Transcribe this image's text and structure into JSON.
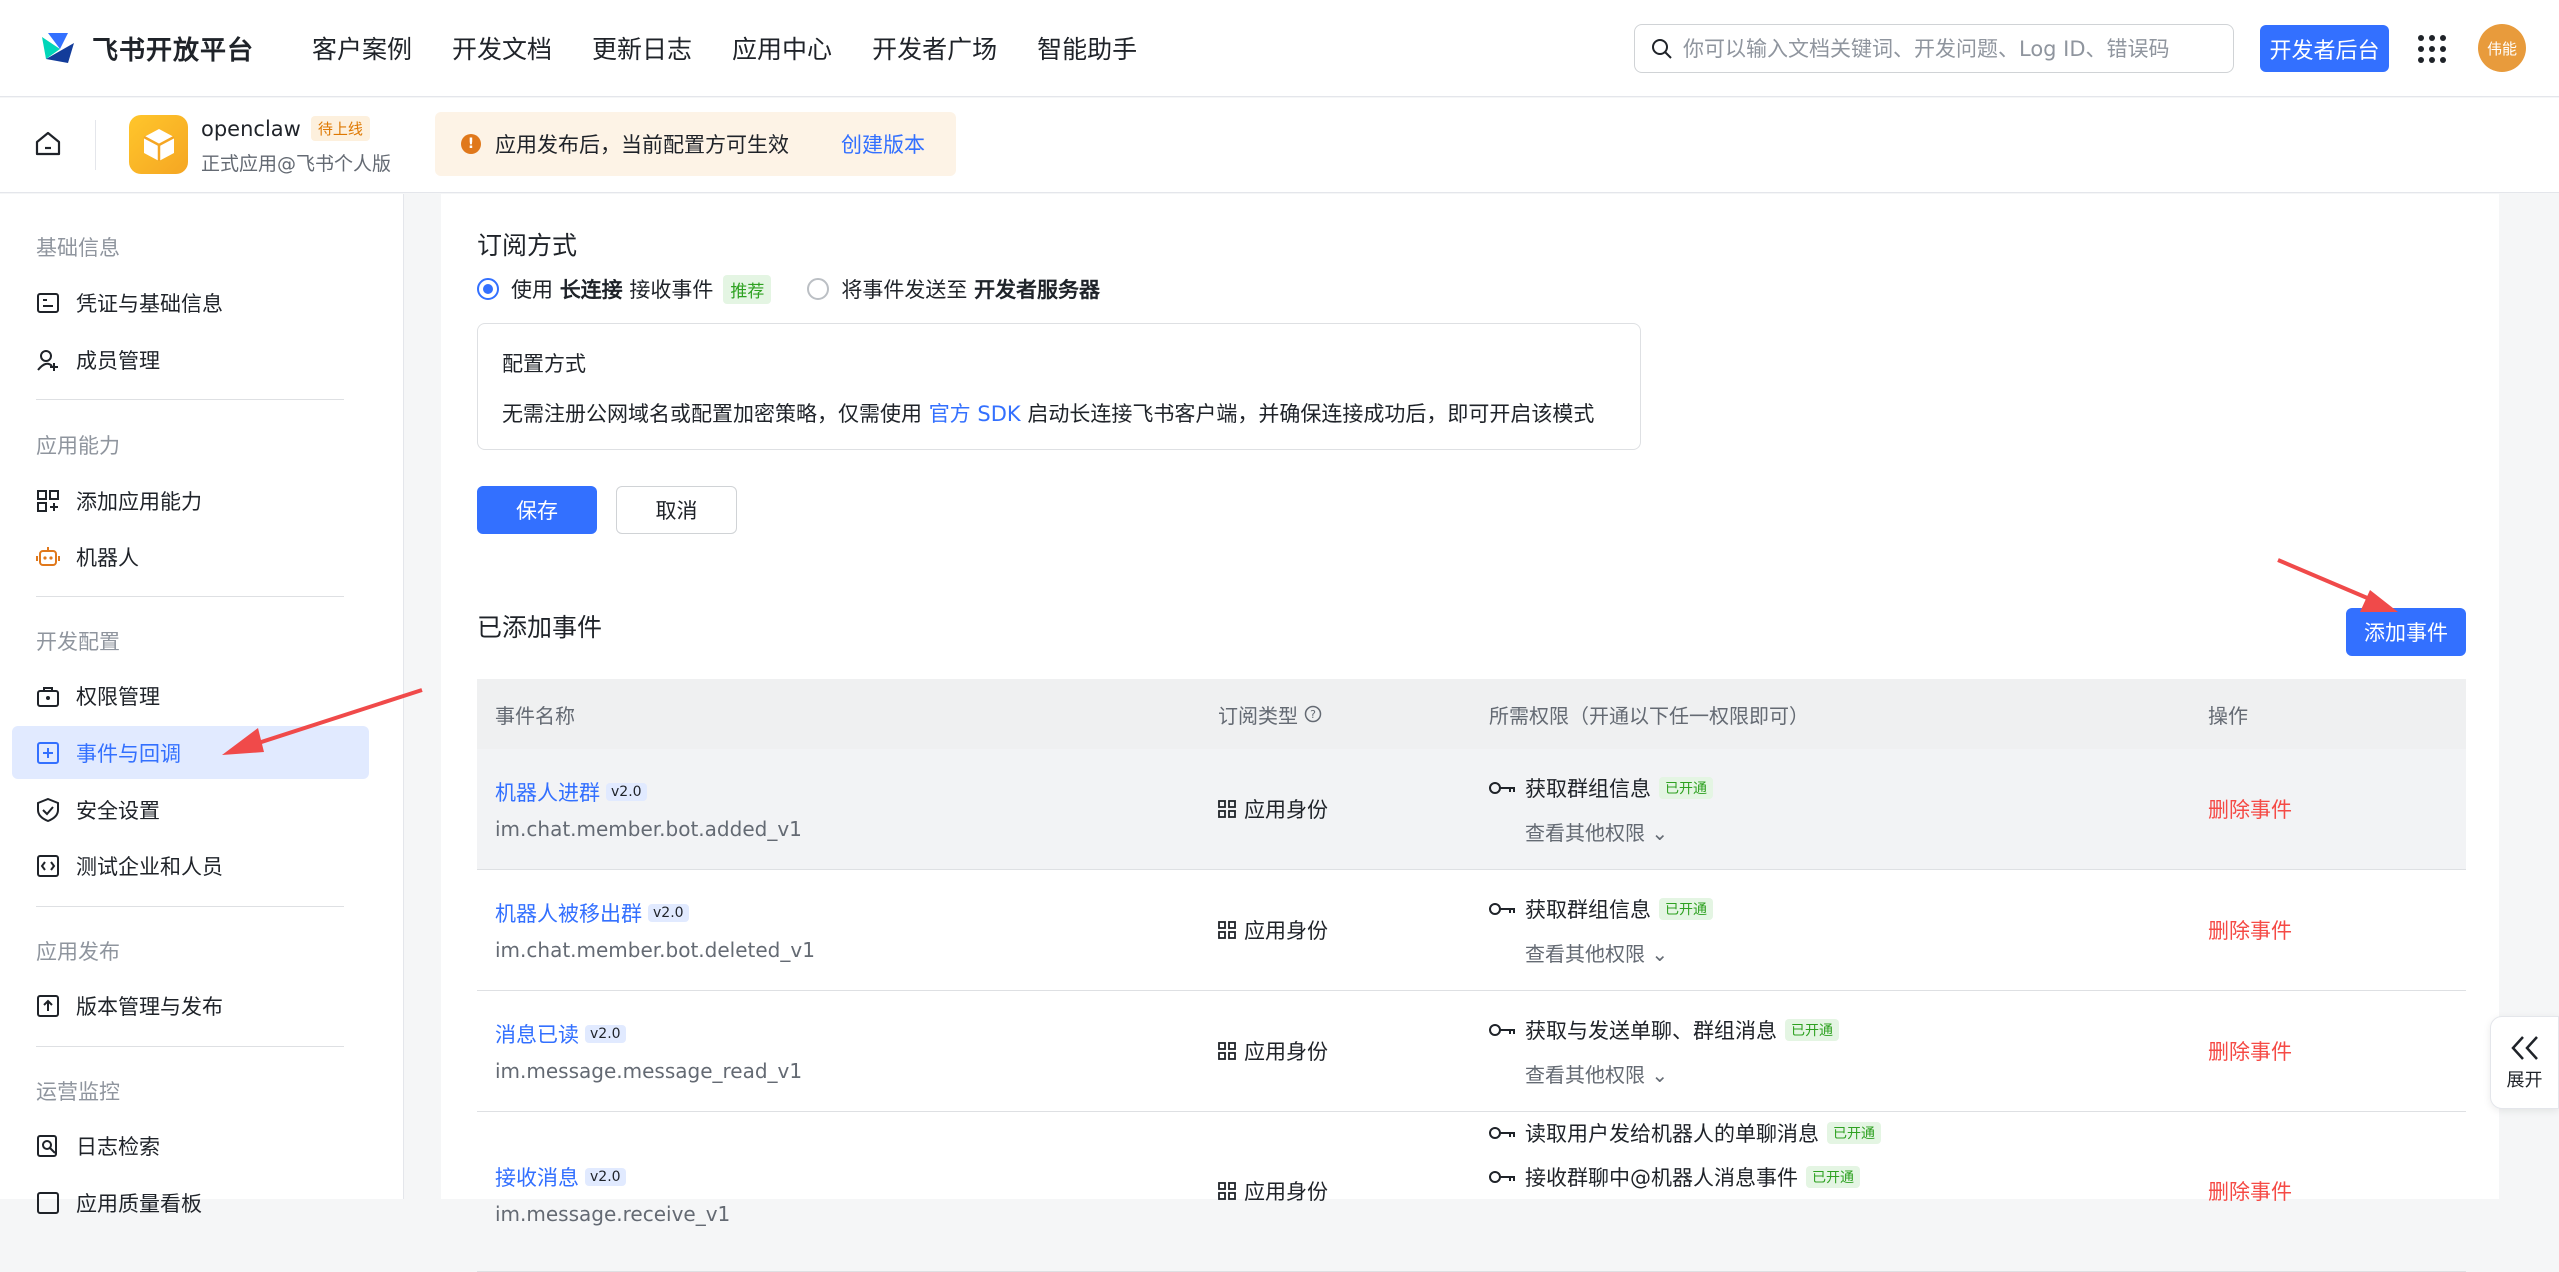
{
  "header": {
    "logo_text": "飞书开放平台",
    "nav": [
      "客户案例",
      "开发文档",
      "更新日志",
      "应用中心",
      "开发者广场",
      "智能助手"
    ],
    "search_placeholder": "你可以输入文档关键词、开发问题、Log ID、错误码",
    "dev_console": "开发者后台",
    "avatar_text": "伟能"
  },
  "app": {
    "name": "openclaw",
    "status": "待上线",
    "subtitle": "正式应用@飞书个人版",
    "notice": "应用发布后，当前配置方可生效",
    "notice_link": "创建版本"
  },
  "sidebar": {
    "sections": [
      {
        "title": "基础信息",
        "items": [
          {
            "label": "凭证与基础信息",
            "icon": "credential-icon"
          },
          {
            "label": "成员管理",
            "icon": "member-icon"
          }
        ]
      },
      {
        "title": "应用能力",
        "items": [
          {
            "label": "添加应用能力",
            "icon": "add-capability-icon"
          },
          {
            "label": "机器人",
            "icon": "robot-icon"
          }
        ]
      },
      {
        "title": "开发配置",
        "items": [
          {
            "label": "权限管理",
            "icon": "permission-icon"
          },
          {
            "label": "事件与回调",
            "icon": "event-icon",
            "active": true
          },
          {
            "label": "安全设置",
            "icon": "shield-icon"
          },
          {
            "label": "测试企业和人员",
            "icon": "code-icon"
          }
        ]
      },
      {
        "title": "应用发布",
        "items": [
          {
            "label": "版本管理与发布",
            "icon": "upload-icon"
          }
        ]
      },
      {
        "title": "运营监控",
        "items": [
          {
            "label": "日志检索",
            "icon": "log-search-icon"
          },
          {
            "label": "应用质量看板",
            "icon": "dashboard-icon"
          }
        ]
      }
    ]
  },
  "subscription": {
    "title": "订阅方式",
    "option1_prefix": "使用",
    "option1_bold": "长连接",
    "option1_suffix": "接收事件",
    "option1_tag": "推荐",
    "option2_prefix": "将事件发送至",
    "option2_bold": "开发者服务器",
    "config_title": "配置方式",
    "config_desc_prefix": "无需注册公网域名或配置加密策略，仅需使用",
    "config_desc_link": "官方 SDK",
    "config_desc_suffix": "启动长连接飞书客户端，并确保连接成功后，即可开启该模式",
    "save": "保存",
    "cancel": "取消"
  },
  "events": {
    "title": "已添加事件",
    "add_button": "添加事件",
    "columns": [
      "事件名称",
      "订阅类型",
      "所需权限（开通以下任一权限即可）",
      "操作"
    ],
    "rows": [
      {
        "name": "机器人进群",
        "version": "v2.0",
        "code": "im.chat.member.bot.added_v1",
        "type": "应用身份",
        "perms": [
          "获取群组信息"
        ],
        "perm_tag": "已开通",
        "more": "查看其他权限",
        "action": "删除事件"
      },
      {
        "name": "机器人被移出群",
        "version": "v2.0",
        "code": "im.chat.member.bot.deleted_v1",
        "type": "应用身份",
        "perms": [
          "获取群组信息"
        ],
        "perm_tag": "已开通",
        "more": "查看其他权限",
        "action": "删除事件"
      },
      {
        "name": "消息已读",
        "version": "v2.0",
        "code": "im.message.message_read_v1",
        "type": "应用身份",
        "perms": [
          "获取与发送单聊、群组消息"
        ],
        "perm_tag": "已开通",
        "more": "查看其他权限",
        "action": "删除事件"
      },
      {
        "name": "接收消息",
        "version": "v2.0",
        "code": "im.message.receive_v1",
        "type": "应用身份",
        "perms": [
          "读取用户发给机器人的单聊消息",
          "接收群聊中@机器人消息事件"
        ],
        "perm_tag": "已开通",
        "more": "",
        "action": "删除事件"
      }
    ]
  },
  "expand_label": "展开",
  "colors": {
    "primary": "#3370ff",
    "danger": "#f54a45",
    "arrow": "#f04a4a"
  }
}
